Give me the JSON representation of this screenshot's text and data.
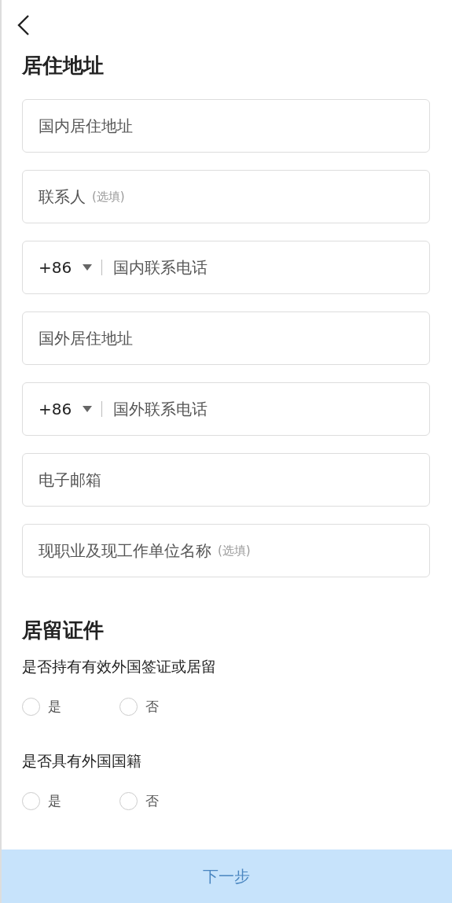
{
  "sections": [
    {
      "title": "居住地址",
      "fields": [
        {
          "kind": "text",
          "placeholder": "国内居住地址"
        },
        {
          "kind": "text",
          "placeholder": "联系人",
          "hint": "(选填)"
        },
        {
          "kind": "phone",
          "code": "+86",
          "placeholder": "国内联系电话"
        },
        {
          "kind": "text",
          "placeholder": "国外居住地址"
        },
        {
          "kind": "phone",
          "code": "+86",
          "placeholder": "国外联系电话"
        },
        {
          "kind": "text",
          "placeholder": "电子邮箱"
        },
        {
          "kind": "text",
          "placeholder": "现职业及现工作单位名称",
          "hint": "(选填)"
        }
      ]
    },
    {
      "title": "居留证件",
      "questions": [
        {
          "label": "是否持有有效外国签证或居留",
          "options": [
            {
              "label": "是",
              "selected": false
            },
            {
              "label": "否",
              "selected": false
            }
          ]
        },
        {
          "label": "是否具有外国国籍",
          "options": [
            {
              "label": "是",
              "selected": false
            },
            {
              "label": "否",
              "selected": false
            }
          ]
        }
      ]
    }
  ],
  "next_button": {
    "label": "下一步",
    "disabled": true
  }
}
